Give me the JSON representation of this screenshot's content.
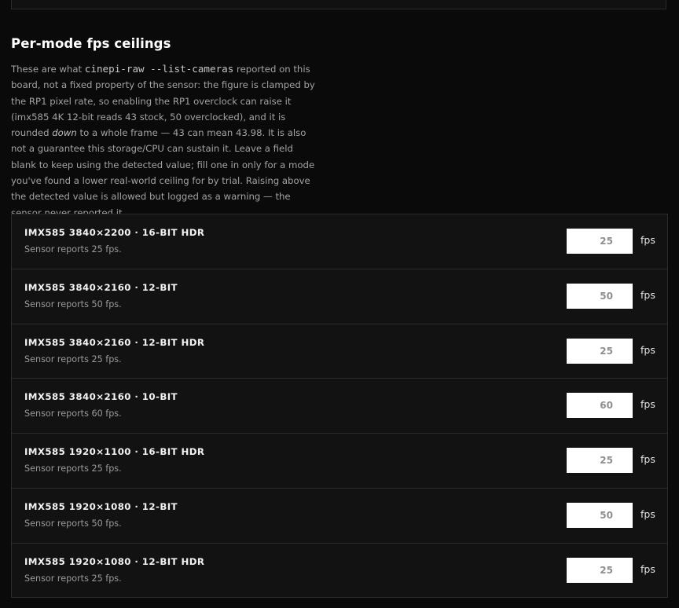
{
  "section": {
    "title": "Per-mode fps ceilings",
    "desc_intro": "These are what ",
    "desc_code": "cinepi-raw --list-cameras",
    "desc_mid": " reported on this board, not a fixed property of the sensor: the figure is clamped by the RP1 pixel rate, so enabling the RP1 overclock can raise it (imx585 4K 12-bit reads 43 stock, 50 overclocked), and it is rounded ",
    "desc_em": "down",
    "desc_end": " to a whole frame — 43 can mean 43.98. It is also not a guarantee this storage/CPU can sustain it. Leave a field blank to keep using the detected value; fill one in only for a mode you've found a lower real-world ceiling for by trial. Raising above the detected value is allowed but logged as a warning — the sensor never reported it."
  },
  "modes": [
    {
      "title": "IMX585 3840×2200 · 16-BIT HDR",
      "subtitle": "Sensor reports 25 fps.",
      "value": "",
      "placeholder": "25",
      "unit": "fps"
    },
    {
      "title": "IMX585 3840×2160 · 12-BIT",
      "subtitle": "Sensor reports 50 fps.",
      "value": "",
      "placeholder": "50",
      "unit": "fps"
    },
    {
      "title": "IMX585 3840×2160 · 12-BIT HDR",
      "subtitle": "Sensor reports 25 fps.",
      "value": "",
      "placeholder": "25",
      "unit": "fps"
    },
    {
      "title": "IMX585 3840×2160 · 10-BIT",
      "subtitle": "Sensor reports 60 fps.",
      "value": "",
      "placeholder": "60",
      "unit": "fps"
    },
    {
      "title": "IMX585 1920×1100 · 16-BIT HDR",
      "subtitle": "Sensor reports 25 fps.",
      "value": "",
      "placeholder": "25",
      "unit": "fps"
    },
    {
      "title": "IMX585 1920×1080 · 12-BIT",
      "subtitle": "Sensor reports 50 fps.",
      "value": "",
      "placeholder": "50",
      "unit": "fps"
    },
    {
      "title": "IMX585 1920×1080 · 12-BIT HDR",
      "subtitle": "Sensor reports 25 fps.",
      "value": "",
      "placeholder": "25",
      "unit": "fps"
    }
  ]
}
